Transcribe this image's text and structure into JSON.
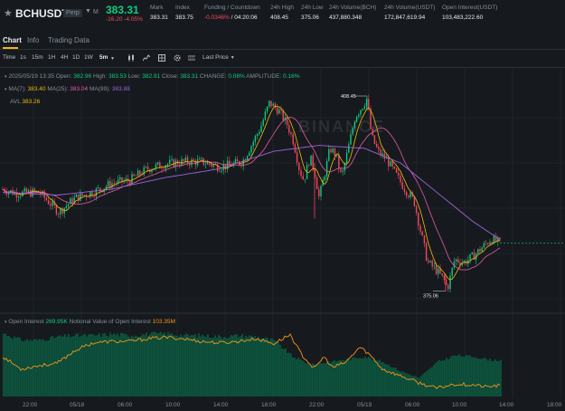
{
  "ticker": {
    "symbol": "BCHUSDT",
    "badge": "Perp",
    "badge2": "M",
    "last_price": "383.31",
    "change": "-16.20",
    "change_pct": "-4.05%",
    "stats": [
      {
        "label": "Mark",
        "value": "383.31"
      },
      {
        "label": "Index",
        "value": "383.75"
      },
      {
        "label": "Funding / Countdown",
        "value": "-0.0346%",
        "value2": "/ 04:20:06"
      },
      {
        "label": "24h High",
        "value": "408.45"
      },
      {
        "label": "24h Low",
        "value": "375.06"
      },
      {
        "label": "24h Volume(BCH)",
        "value": "437,880.348"
      },
      {
        "label": "24h Volume(USDT)",
        "value": "172,847,619.94"
      },
      {
        "label": "Open Interest(USDT)",
        "value": "103,483,222.60"
      }
    ]
  },
  "tabs": [
    "Chart",
    "Info",
    "Trading Data"
  ],
  "toolbar": {
    "intervals": [
      "Time",
      "1s",
      "15m",
      "1H",
      "4H",
      "1D",
      "1W",
      "5m"
    ],
    "selected": "5m",
    "price_type": "Last Price"
  },
  "legend": {
    "datetime": "2025/05/19 13:35",
    "open_label": "Open:",
    "open": "382.96",
    "high_label": "High:",
    "high": "383.53",
    "low_label": "Low:",
    "low": "382.91",
    "close_label": "Close:",
    "close": "383.31",
    "change_label": "CHANGE:",
    "change": "0.08%",
    "amp_label": "AMPLITUDE:",
    "amp": "0.16%",
    "ma7_label": "MA(7):",
    "ma7": "383.40",
    "ma25_label": "MA(25):",
    "ma25": "383.04",
    "ma99_label": "MA(99):",
    "ma99": "383.88",
    "avl_label": "AVL",
    "avl": "383.26"
  },
  "watermark": "BINANCE",
  "oi": {
    "title": "Open Interest",
    "value": "269.95K",
    "notional_label": "Notional Value of Open Interest",
    "notional": "103.35M"
  },
  "colors": {
    "up": "#0ecb81",
    "down": "#f6465d",
    "ma7": "#f0b90b",
    "ma25": "#e65aa6",
    "ma99": "#9d63d8",
    "oi_line": "#f7931a"
  },
  "chart_data": {
    "type": "candlestick",
    "interval": "5m",
    "x_ticks": [
      "22:00",
      "05/18",
      "06:00",
      "10:00",
      "14:00",
      "18:00",
      "22:00",
      "05/19",
      "06:00",
      "10:00",
      "14:00",
      "18:00"
    ],
    "high_marker": "408.45",
    "low_marker": "375.06",
    "price_anchors": [
      [
        0,
        392.5
      ],
      [
        15,
        391.8
      ],
      [
        40,
        392.0
      ],
      [
        62,
        388.6
      ],
      [
        80,
        391.0
      ],
      [
        100,
        392.0
      ],
      [
        120,
        393.5
      ],
      [
        140,
        394.0
      ],
      [
        160,
        396.0
      ],
      [
        180,
        396.8
      ],
      [
        200,
        397.2
      ],
      [
        220,
        397.2
      ],
      [
        240,
        396.3
      ],
      [
        255,
        396.8
      ],
      [
        265,
        397.2
      ],
      [
        275,
        400.0
      ],
      [
        285,
        403.0
      ],
      [
        295,
        407.3
      ],
      [
        305,
        406.0
      ],
      [
        315,
        403.5
      ],
      [
        322,
        400.5
      ],
      [
        328,
        396.0
      ],
      [
        333,
        394.0
      ],
      [
        340,
        398.0
      ],
      [
        345,
        395.5
      ],
      [
        350,
        391.0
      ],
      [
        356,
        395.0
      ],
      [
        362,
        399.5
      ],
      [
        368,
        398.5
      ],
      [
        375,
        394.5
      ],
      [
        383,
        400.0
      ],
      [
        390,
        405.0
      ],
      [
        397,
        406.5
      ],
      [
        403,
        408.0
      ],
      [
        408,
        401.5
      ],
      [
        415,
        399.0
      ],
      [
        425,
        397.5
      ],
      [
        435,
        395.0
      ],
      [
        445,
        392.5
      ],
      [
        455,
        390.5
      ],
      [
        462,
        385.5
      ],
      [
        470,
        380.0
      ],
      [
        480,
        378.6
      ],
      [
        488,
        377.0
      ],
      [
        492,
        375.5
      ],
      [
        500,
        380.5
      ],
      [
        510,
        380.0
      ],
      [
        520,
        381.0
      ],
      [
        530,
        382.5
      ],
      [
        540,
        384.0
      ],
      [
        550,
        383.3
      ]
    ],
    "ma99_anchors": [
      [
        0,
        392.0
      ],
      [
        60,
        391.5
      ],
      [
        120,
        392.5
      ],
      [
        180,
        394.5
      ],
      [
        240,
        396.0
      ],
      [
        300,
        399.0
      ],
      [
        350,
        400.0
      ],
      [
        400,
        399.5
      ],
      [
        440,
        397.0
      ],
      [
        480,
        392.0
      ],
      [
        520,
        387.0
      ],
      [
        550,
        383.9
      ]
    ],
    "oi_anchors": [
      [
        0,
        0.58
      ],
      [
        20,
        0.4
      ],
      [
        40,
        0.45
      ],
      [
        60,
        0.48
      ],
      [
        80,
        0.67
      ],
      [
        100,
        0.78
      ],
      [
        120,
        0.8
      ],
      [
        140,
        0.8
      ],
      [
        160,
        0.84
      ],
      [
        180,
        0.86
      ],
      [
        200,
        0.84
      ],
      [
        220,
        0.8
      ],
      [
        240,
        0.78
      ],
      [
        260,
        0.8
      ],
      [
        280,
        0.84
      ],
      [
        300,
        0.77
      ],
      [
        318,
        0.9
      ],
      [
        330,
        0.62
      ],
      [
        345,
        0.4
      ],
      [
        355,
        0.58
      ],
      [
        365,
        0.42
      ],
      [
        380,
        0.5
      ],
      [
        395,
        0.72
      ],
      [
        405,
        0.62
      ],
      [
        420,
        0.4
      ],
      [
        440,
        0.3
      ],
      [
        460,
        0.2
      ],
      [
        480,
        0.12
      ],
      [
        500,
        0.18
      ],
      [
        520,
        0.17
      ],
      [
        535,
        0.14
      ],
      [
        550,
        0.16
      ]
    ],
    "nv_anchors": [
      [
        0,
        0.95
      ],
      [
        20,
        0.85
      ],
      [
        40,
        0.85
      ],
      [
        60,
        0.9
      ],
      [
        80,
        0.92
      ],
      [
        100,
        0.92
      ],
      [
        120,
        0.94
      ],
      [
        140,
        0.92
      ],
      [
        160,
        0.94
      ],
      [
        180,
        0.95
      ],
      [
        200,
        0.92
      ],
      [
        220,
        0.92
      ],
      [
        240,
        0.9
      ],
      [
        260,
        0.92
      ],
      [
        280,
        0.9
      ],
      [
        300,
        0.84
      ],
      [
        320,
        0.6
      ],
      [
        340,
        0.48
      ],
      [
        360,
        0.52
      ],
      [
        380,
        0.56
      ],
      [
        400,
        0.6
      ],
      [
        420,
        0.52
      ],
      [
        440,
        0.38
      ],
      [
        460,
        0.28
      ],
      [
        480,
        0.52
      ],
      [
        500,
        0.62
      ],
      [
        520,
        0.6
      ],
      [
        540,
        0.55
      ],
      [
        550,
        0.55
      ]
    ]
  }
}
